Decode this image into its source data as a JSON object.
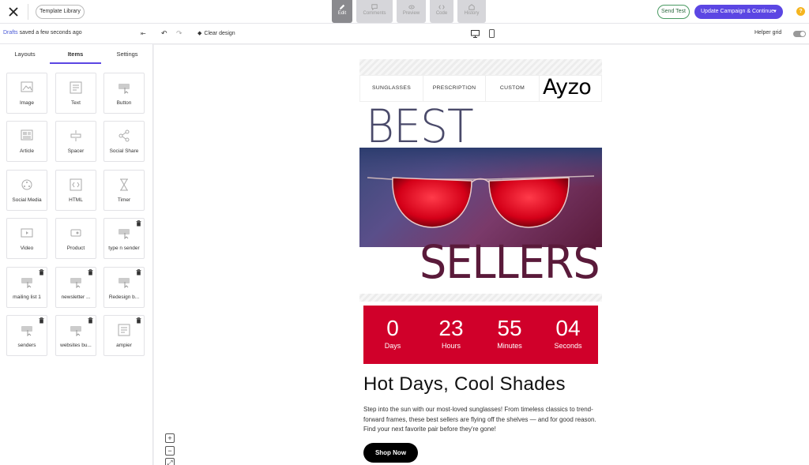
{
  "topbar": {
    "template_library": "Template Library",
    "modes": [
      {
        "label": "Edit",
        "icon": "pencil-icon"
      },
      {
        "label": "Comments",
        "icon": "comment-icon"
      },
      {
        "label": "Preview",
        "icon": "eye-icon"
      },
      {
        "label": "Code",
        "icon": "code-icon"
      },
      {
        "label": "History",
        "icon": "history-icon"
      }
    ],
    "send_test": "Send Test",
    "update": "Update Campaign & Continue",
    "help": "?"
  },
  "toolbar": {
    "drafts_link": "Drafts",
    "saved_status": " saved a few seconds ago",
    "clear_design": "Clear design",
    "helper_grid": "Helper grid"
  },
  "panel": {
    "tabs": [
      "Layouts",
      "Items",
      "Settings"
    ],
    "active_tab": "Items",
    "items": [
      {
        "label": "Image",
        "icon": "image-icon",
        "deletable": false
      },
      {
        "label": "Text",
        "icon": "text-icon",
        "deletable": false
      },
      {
        "label": "Button",
        "icon": "button-icon",
        "deletable": false
      },
      {
        "label": "Article",
        "icon": "article-icon",
        "deletable": false
      },
      {
        "label": "Spacer",
        "icon": "spacer-icon",
        "deletable": false
      },
      {
        "label": "Social Share",
        "icon": "share-icon",
        "deletable": false
      },
      {
        "label": "Social Media",
        "icon": "social-media-icon",
        "deletable": false
      },
      {
        "label": "HTML",
        "icon": "html-icon",
        "deletable": false
      },
      {
        "label": "Timer",
        "icon": "hourglass-icon",
        "deletable": false
      },
      {
        "label": "Video",
        "icon": "video-icon",
        "deletable": false
      },
      {
        "label": "Product",
        "icon": "product-icon",
        "deletable": false
      },
      {
        "label": "type n sender",
        "icon": "saved-block-icon",
        "deletable": true
      },
      {
        "label": "mailing list 1",
        "icon": "saved-block-icon",
        "deletable": true
      },
      {
        "label": "newsletter ...",
        "icon": "saved-block-icon",
        "deletable": true
      },
      {
        "label": "Redesign b...",
        "icon": "saved-block-icon",
        "deletable": true
      },
      {
        "label": "senders",
        "icon": "saved-block-icon",
        "deletable": true
      },
      {
        "label": "websites bu...",
        "icon": "saved-block-icon",
        "deletable": true
      },
      {
        "label": "ampier",
        "icon": "text-icon",
        "deletable": true
      }
    ]
  },
  "email": {
    "nav": [
      "SUNGLASSES",
      "PRESCRIPTION",
      "CUSTOM"
    ],
    "logo": "Ayzo",
    "hero_top": "BEST",
    "hero_bottom": "SELLERS",
    "countdown": [
      {
        "value": "0",
        "unit": "Days"
      },
      {
        "value": "23",
        "unit": "Hours"
      },
      {
        "value": "55",
        "unit": "Minutes"
      },
      {
        "value": "04",
        "unit": "Seconds"
      }
    ],
    "headline": "Hot Days, Cool Shades",
    "body": "Step into the sun with our most-loved sunglasses! From timeless classics to trend-forward frames, these best sellers are flying off the shelves — and for good reason. Find your next favorite pair before they're gone!",
    "cta": "Shop Now"
  },
  "zoom": {
    "in": "+",
    "out": "−",
    "fit": "⤢"
  },
  "colors": {
    "accent": "#5b46e3",
    "countdown_bg": "#d0002a",
    "send_test_border": "#4a9a62",
    "help": "#f5b51f"
  }
}
